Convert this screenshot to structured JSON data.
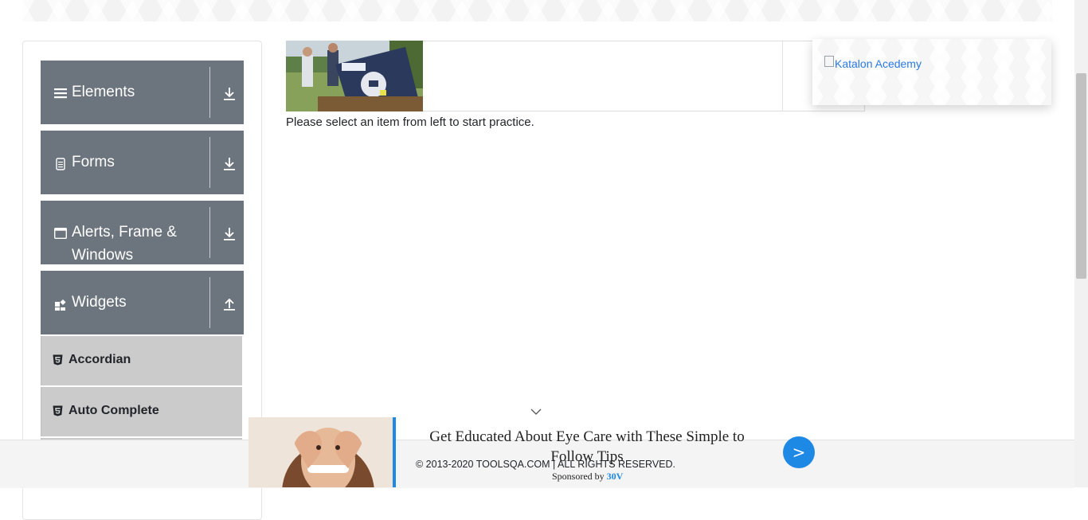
{
  "sidebar": {
    "groups": [
      {
        "label": "Elements",
        "icon": "hamburger-icon",
        "arrow": "download-arrow-icon"
      },
      {
        "label": "Forms",
        "icon": "document-icon",
        "arrow": "download-arrow-icon"
      },
      {
        "label": "Alerts, Frame &",
        "label2": "Windows",
        "icon": "window-icon",
        "arrow": "download-arrow-icon"
      },
      {
        "label": "Widgets",
        "icon": "grid-icon",
        "arrow": "upload-arrow-icon"
      }
    ],
    "widget_items": [
      {
        "label": "Accordian",
        "icon": "html5-icon"
      },
      {
        "label": "Auto Complete",
        "icon": "html5-icon"
      }
    ]
  },
  "main": {
    "instruction": "Please select an item from left to start practice."
  },
  "katalon": {
    "link_text": "Katalon Acedemy"
  },
  "footer": {
    "copyright": "© 2013-2020 TOOLSQA.COM | ALL RIGHTS RESERVED."
  },
  "sticky_ad": {
    "title": "Get Educated About Eye Care with These Simple to Follow Tips",
    "sponsor_prefix": "Sponsored by ",
    "sponsor_brand": "30V",
    "go_label": ">"
  },
  "colors": {
    "group_header_bg": "#6c757d",
    "menu_item_bg": "#cbcbcb",
    "link": "#2a7ae2",
    "ad_accent": "#1e88e5"
  }
}
